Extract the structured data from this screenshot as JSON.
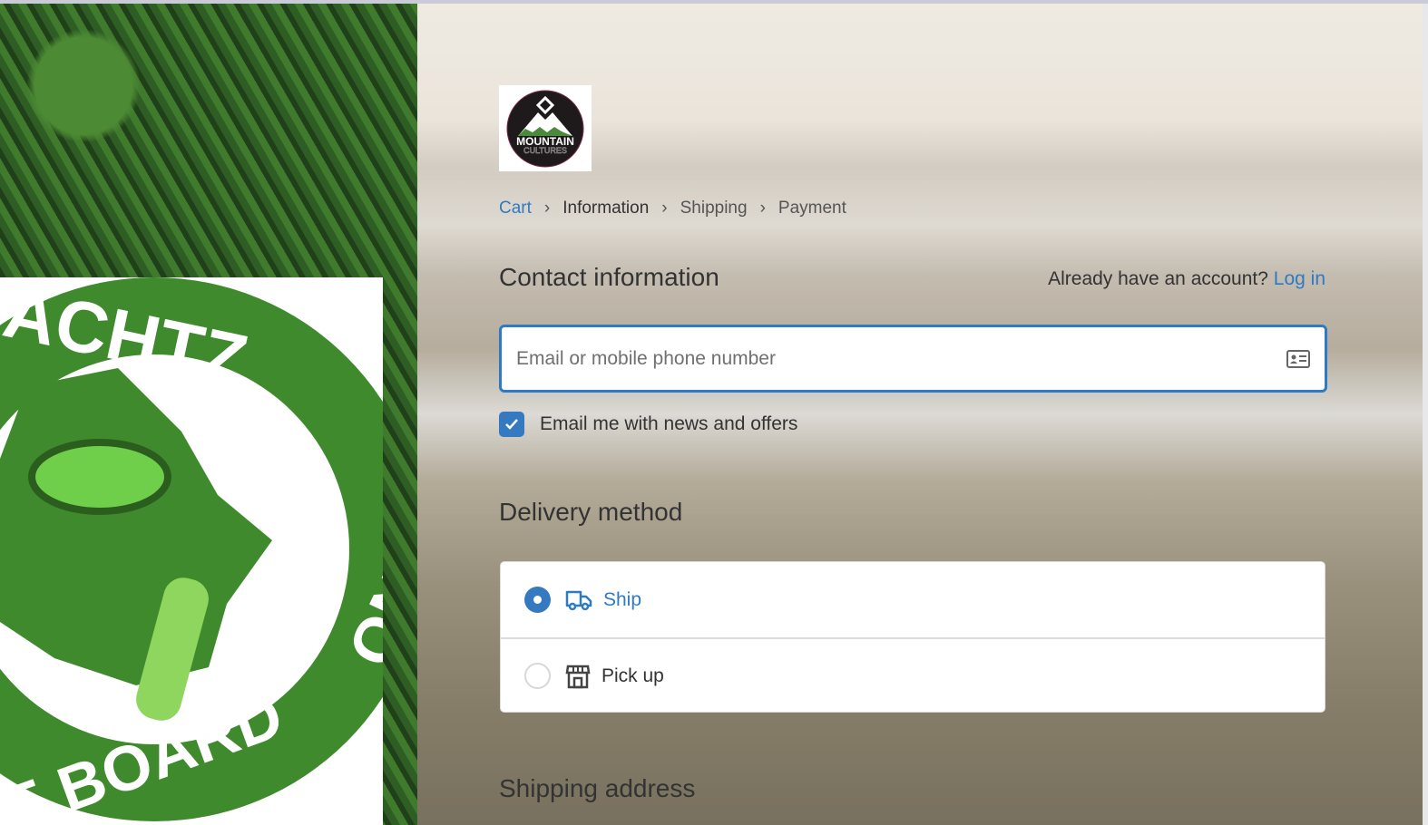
{
  "brand": {
    "logo_text": "MOUNTAIN CULTURES"
  },
  "side_logo": {
    "text": "ACHTZ ONE TREE E BOARD"
  },
  "breadcrumb": {
    "items": [
      "Cart",
      "Information",
      "Shipping",
      "Payment"
    ]
  },
  "contact": {
    "title": "Contact information",
    "account_prompt": "Already have an account?",
    "login": "Log in",
    "email_placeholder": "Email or mobile phone number",
    "email_value": "",
    "newsletter_label": "Email me with news and offers",
    "newsletter_checked": true
  },
  "delivery": {
    "title": "Delivery method",
    "options": [
      {
        "label": "Ship",
        "icon": "truck-icon",
        "selected": true
      },
      {
        "label": "Pick up",
        "icon": "store-icon",
        "selected": false
      }
    ]
  },
  "shipping": {
    "title": "Shipping address"
  },
  "colors": {
    "accent": "#2f7ac4",
    "logo_green": "#3f8a2c"
  }
}
